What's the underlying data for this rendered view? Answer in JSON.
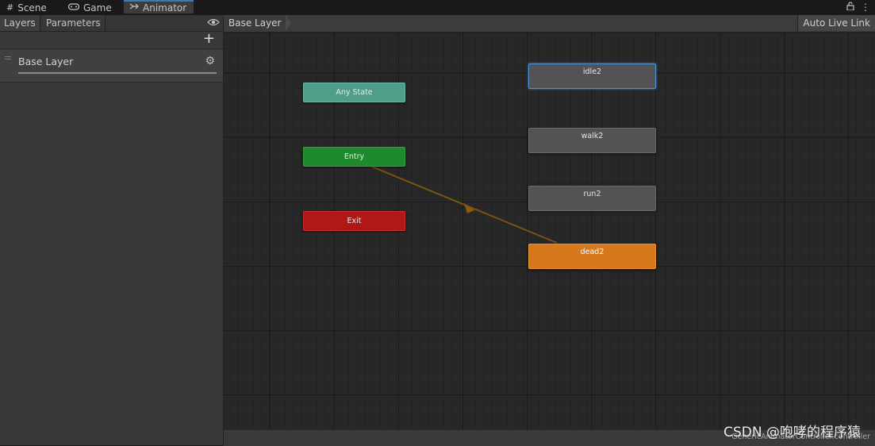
{
  "tabs": [
    {
      "label": "Scene",
      "icon": "grid-icon"
    },
    {
      "label": "Game",
      "icon": "gamepad-icon"
    },
    {
      "label": "Animator",
      "icon": "animator-icon"
    }
  ],
  "tab_tools": {
    "lock": "🔓",
    "menu": "⋮"
  },
  "left_panel": {
    "tabs": [
      "Layers",
      "Parameters"
    ],
    "eye_icon": "eye-icon",
    "add_label": "+",
    "layers": [
      {
        "name": "Base Layer",
        "settings_icon": "gear-icon"
      }
    ]
  },
  "graph": {
    "breadcrumb": "Base Layer",
    "auto_live_link": "Auto Live Link",
    "nodes": {
      "any_state": "Any State",
      "entry": "Entry",
      "exit": "Exit"
    },
    "states": [
      "idle2",
      "walk2",
      "run2",
      "dead2"
    ],
    "default_state": "dead2",
    "selected_state": "idle2",
    "controller_path": "GenericAnimatorController.controller"
  },
  "watermark": "CSDN @咆哮的程序猿",
  "colors": {
    "any_state": "#4f9e8a",
    "entry": "#1d8a2e",
    "exit": "#b01818",
    "default_state": "#d7781c",
    "transition": "#8a5a10",
    "accent": "#3a79bb"
  }
}
